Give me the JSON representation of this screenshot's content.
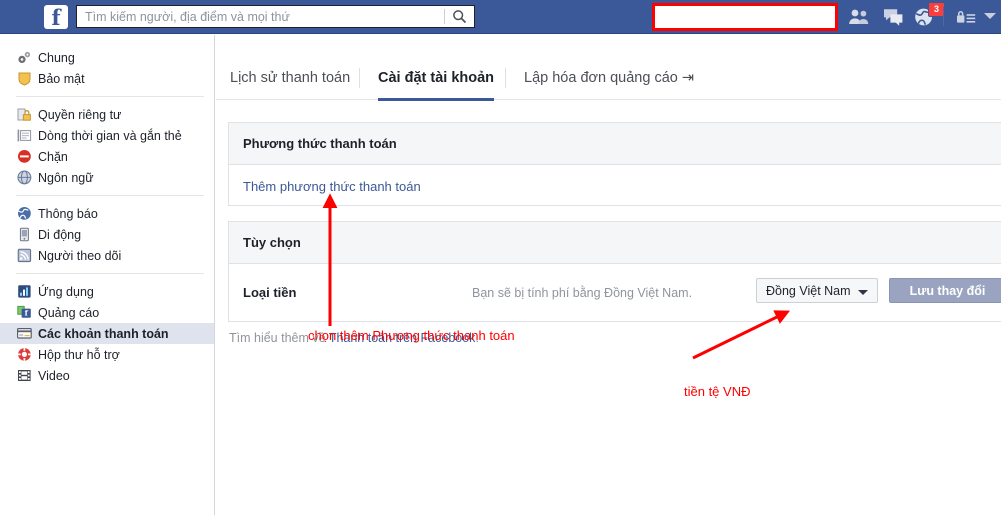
{
  "header": {
    "logo": "f",
    "search": {
      "placeholder": "Tìm kiếm người, địa điểm và mọi thứ",
      "value": ""
    },
    "redacted_name_box": "",
    "icons": [
      {
        "name": "friends-icon",
        "label": "Bạn bè"
      },
      {
        "name": "messages-icon",
        "label": "Tin nhắn"
      },
      {
        "name": "notifications-globe-icon",
        "label": "Thông báo"
      },
      {
        "name": "privacy-lock-icon",
        "label": "Lối tắt quyền riêng tư"
      },
      {
        "name": "account-menu-caret-icon",
        "label": "Menu tài khoản"
      }
    ],
    "notification_badge": "3",
    "colors": {
      "bar": "#3b5998",
      "badge": "#fa3e3e",
      "highlight_box_border": "#ff0000"
    }
  },
  "sidebar": {
    "groups": [
      {
        "items": [
          {
            "label": "Chung",
            "icon": "gear-icon",
            "selected": false
          },
          {
            "label": "Bảo mật",
            "icon": "shield-icon",
            "selected": false
          }
        ]
      },
      {
        "items": [
          {
            "label": "Quyền riêng tư",
            "icon": "lock-icon",
            "selected": false
          },
          {
            "label": "Dòng thời gian và gắn thẻ",
            "icon": "timeline-icon",
            "selected": false
          },
          {
            "label": "Chặn",
            "icon": "block-icon",
            "selected": false
          },
          {
            "label": "Ngôn ngữ",
            "icon": "language-globe-icon",
            "selected": false
          }
        ]
      },
      {
        "items": [
          {
            "label": "Thông báo",
            "icon": "notifications-globe-icon",
            "selected": false
          },
          {
            "label": "Di động",
            "icon": "mobile-icon",
            "selected": false
          },
          {
            "label": "Người theo dõi",
            "icon": "rss-follower-icon",
            "selected": false
          }
        ]
      },
      {
        "items": [
          {
            "label": "Ứng dụng",
            "icon": "apps-icon",
            "selected": false
          },
          {
            "label": "Quảng cáo",
            "icon": "ads-icon",
            "selected": false
          },
          {
            "label": "Các khoản thanh toán",
            "icon": "payments-card-icon",
            "selected": true
          },
          {
            "label": "Hộp thư hỗ trợ",
            "icon": "support-lifebuoy-icon",
            "selected": false
          },
          {
            "label": "Video",
            "icon": "film-video-icon",
            "selected": false
          }
        ]
      }
    ],
    "selected_highlight_color": "#dfe3ee"
  },
  "main": {
    "tabs": [
      {
        "label": "Lịch sử thanh toán",
        "active": false
      },
      {
        "label": "Cài đặt tài khoản",
        "active": true
      },
      {
        "label": "Lập hóa đơn quảng cáo ⇥",
        "active": false
      }
    ],
    "payment_card": {
      "title": "Phương thức thanh toán",
      "add_link": "Thêm phương thức thanh toán"
    },
    "options_card": {
      "title": "Tùy chọn",
      "currency_label": "Loại tiền",
      "currency_description": "Bạn sẽ bị tính phí bằng Đồng Việt Nam.",
      "currency_value": "Đồng Việt Nam",
      "save_label": "Lưu thay đổi"
    },
    "footer": {
      "text_before": "Tìm hiểu thêm về ",
      "link": "Thanh toán trên Facebook",
      "text_after": "."
    }
  },
  "annotations": {
    "color": "#ff0000",
    "items": [
      {
        "text": "chọn thêm Phương thức thanh toán",
        "arrow": "vertical-up"
      },
      {
        "text": "tiền tệ VNĐ",
        "arrow": "diagonal-up-right"
      }
    ]
  }
}
